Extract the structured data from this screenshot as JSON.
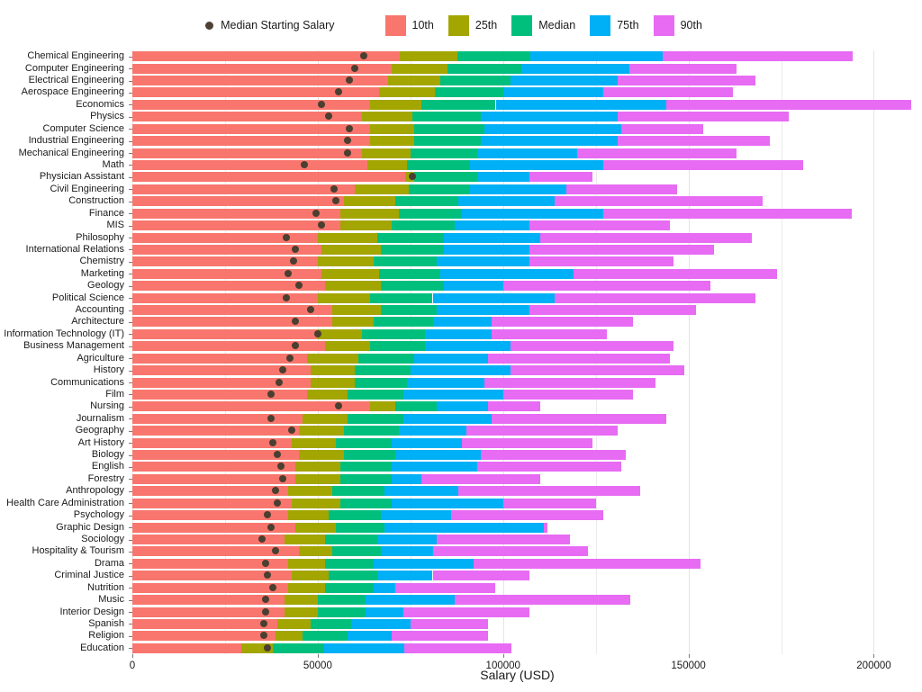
{
  "legend": {
    "point_label": "Median Starting Salary",
    "point_color": "#4d4032",
    "items": [
      {
        "label": "10th",
        "color": "#F8766D"
      },
      {
        "label": "25th",
        "color": "#A3A500"
      },
      {
        "label": "Median",
        "color": "#00BF7D"
      },
      {
        "label": "75th",
        "color": "#00B0F6"
      },
      {
        "label": "90th",
        "color": "#E76BF3"
      }
    ]
  },
  "axes": {
    "x_title": "Salary (USD)",
    "x_ticks": [
      0,
      50000,
      100000,
      150000,
      200000
    ],
    "x_tick_labels": [
      "0",
      "50000",
      "100000",
      "150000",
      "200000"
    ],
    "x_min": 0,
    "x_max": 213000,
    "y_title": ""
  },
  "chart_data": {
    "type": "bar",
    "title": "",
    "subtitle": "",
    "xlabel": "Salary (USD)",
    "ylabel": "",
    "xlim": [
      0,
      213000
    ],
    "grid": true,
    "legend_position": "top",
    "orientation": "horizontal",
    "stacked_segments": [
      "10th",
      "25th",
      "Median",
      "75th",
      "90th"
    ],
    "segment_colors": [
      "#F8766D",
      "#A3A500",
      "#00BF7D",
      "#00B0F6",
      "#E76BF3"
    ],
    "point_series": {
      "name": "Median Starting Salary",
      "color": "#4d4032"
    },
    "categories": [
      "Chemical Engineering",
      "Computer Engineering",
      "Electrical Engineering",
      "Aerospace Engineering",
      "Economics",
      "Physics",
      "Computer Science",
      "Industrial Engineering",
      "Mechanical Engineering",
      "Math",
      "Physician Assistant",
      "Civil Engineering",
      "Construction",
      "Finance",
      "MIS",
      "Philosophy",
      "International Relations",
      "Chemistry",
      "Marketing",
      "Geology",
      "Political Science",
      "Accounting",
      "Architecture",
      "Information Technology (IT)",
      "Business Management",
      "Agriculture",
      "History",
      "Communications",
      "Film",
      "Nursing",
      "Journalism",
      "Geography",
      "Art History",
      "Biology",
      "English",
      "Forestry",
      "Anthropology",
      "Health Care Administration",
      "Psychology",
      "Graphic Design",
      "Sociology",
      "Hospitality & Tourism",
      "Drama",
      "Criminal Justice",
      "Nutrition",
      "Music",
      "Interior Design",
      "Spanish",
      "Religion",
      "Education"
    ],
    "series": [
      {
        "name": "10th",
        "values": [
          72200,
          70000,
          69000,
          66500,
          64000,
          62000,
          64000,
          64000,
          62000,
          63500,
          73500,
          60000,
          57000,
          56000,
          56000,
          50000,
          51000,
          50000,
          51000,
          52000,
          50000,
          54000,
          54000,
          50000,
          52000,
          47000,
          48000,
          48000,
          47000,
          64000,
          46000,
          45000,
          43000,
          45000,
          44000,
          44000,
          42000,
          43000,
          42000,
          44000,
          41000,
          45000,
          42000,
          43000,
          42000,
          41000,
          41000,
          39000,
          38500,
          29400
        ]
      },
      {
        "name": "25th",
        "values": [
          87700,
          85000,
          83000,
          81500,
          78000,
          75500,
          76000,
          76000,
          75000,
          74000,
          76000,
          74500,
          71000,
          72000,
          70000,
          66000,
          67000,
          65000,
          66500,
          67000,
          64000,
          67000,
          65000,
          62000,
          64000,
          61000,
          60000,
          60000,
          58000,
          71000,
          58000,
          57000,
          55000,
          57000,
          56000,
          56000,
          54000,
          56000,
          53000,
          55000,
          52000,
          54000,
          52000,
          53000,
          52000,
          50000,
          50000,
          48000,
          46000,
          37900
        ]
      },
      {
        "name": "Median",
        "values": [
          107400,
          105000,
          102000,
          100000,
          98000,
          94000,
          95000,
          94000,
          93000,
          91000,
          93000,
          91000,
          88000,
          89000,
          87000,
          84000,
          84000,
          82000,
          83000,
          84000,
          81000,
          82000,
          81000,
          79000,
          79000,
          76000,
          75000,
          74000,
          73000,
          82000,
          73000,
          72000,
          70000,
          71000,
          70000,
          70000,
          68000,
          70000,
          67000,
          68000,
          66000,
          67000,
          65000,
          66000,
          65000,
          63000,
          63000,
          59000,
          58000,
          51800
        ]
      },
      {
        "name": "75th",
        "values": [
          143100,
          134000,
          131000,
          127000,
          144000,
          131000,
          132000,
          131000,
          120000,
          127000,
          107000,
          117000,
          114000,
          127000,
          107000,
          110000,
          107000,
          107000,
          119000,
          100000,
          114000,
          107000,
          97000,
          97000,
          102000,
          96000,
          102000,
          95000,
          100000,
          96000,
          97000,
          90000,
          89000,
          94000,
          93000,
          78000,
          88000,
          100000,
          86000,
          111000,
          82000,
          81000,
          92000,
          81000,
          71000,
          87000,
          73000,
          75000,
          70000,
          73400
        ]
      },
      {
        "name": "90th",
        "values": [
          194400,
          163000,
          168000,
          162000,
          210200,
          177000,
          154000,
          172000,
          163000,
          181000,
          124000,
          147000,
          170000,
          194000,
          145000,
          167000,
          157000,
          146000,
          174000,
          156000,
          168000,
          152000,
          135000,
          128000,
          146000,
          145000,
          149000,
          141000,
          135000,
          110000,
          144000,
          131000,
          124000,
          133000,
          132000,
          110000,
          137000,
          125000,
          127000,
          112000,
          118000,
          123000,
          153300,
          107000,
          98000,
          134300,
          107000,
          96000,
          96000,
          102300
        ]
      },
      {
        "name": "Median Starting Salary",
        "values": [
          62500,
          60000,
          58500,
          55500,
          51000,
          53000,
          58500,
          58000,
          58000,
          46500,
          75500,
          54500,
          55000,
          49500,
          51000,
          41500,
          44000,
          43500,
          42000,
          45000,
          41500,
          48000,
          44000,
          50000,
          44000,
          42500,
          40500,
          39500,
          37500,
          55500,
          37500,
          43000,
          38000,
          39000,
          40000,
          40500,
          38500,
          39000,
          36500,
          37500,
          35000,
          38500,
          36000,
          36500,
          38000,
          36000,
          36000,
          35500,
          35500,
          36500
        ]
      }
    ]
  }
}
